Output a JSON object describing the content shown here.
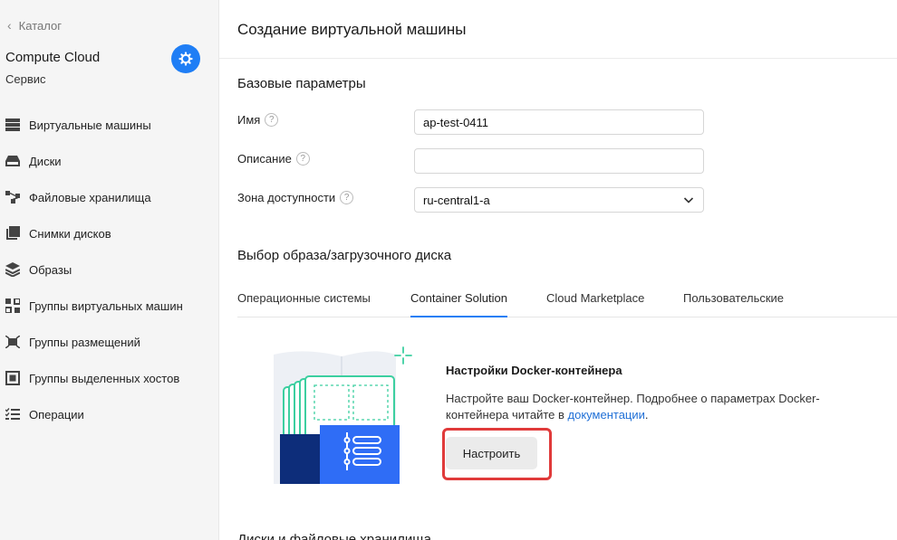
{
  "sidebar": {
    "back_label": "Каталог",
    "service_title": "Compute Cloud",
    "service_subtitle": "Сервис",
    "items": [
      {
        "label": "Виртуальные машины",
        "icon": "server-list-icon"
      },
      {
        "label": "Диски",
        "icon": "disk-icon"
      },
      {
        "label": "Файловые хранилища",
        "icon": "file-storage-icon"
      },
      {
        "label": "Снимки дисков",
        "icon": "snapshots-icon"
      },
      {
        "label": "Образы",
        "icon": "images-layers-icon"
      },
      {
        "label": "Группы виртуальных машин",
        "icon": "vm-groups-icon"
      },
      {
        "label": "Группы размещений",
        "icon": "placement-groups-icon"
      },
      {
        "label": "Группы выделенных хостов",
        "icon": "dedicated-hosts-icon"
      },
      {
        "label": "Операции",
        "icon": "operations-list-icon"
      }
    ]
  },
  "main": {
    "title": "Создание виртуальной машины",
    "basic_section": "Базовые параметры",
    "fields": {
      "name_label": "Имя",
      "name_value": "ap-test-0411",
      "description_label": "Описание",
      "description_value": "",
      "zone_label": "Зона доступности",
      "zone_value": "ru-central1-a"
    },
    "image_section": "Выбор образа/загрузочного диска",
    "tabs": [
      {
        "label": "Операционные системы",
        "active": false
      },
      {
        "label": "Container Solution",
        "active": true
      },
      {
        "label": "Cloud Marketplace",
        "active": false
      },
      {
        "label": "Пользовательские",
        "active": false
      }
    ],
    "docker": {
      "title": "Настройки Docker-контейнера",
      "text": "Настройте ваш Docker-контейнер. Подробнее о параметрах Docker-контейнера читайте в ",
      "link": "документации",
      "text_end": ".",
      "button": "Настроить"
    },
    "cut_off_section": "Диски и файловые хранилища"
  },
  "colors": {
    "accent": "#1f7ef5",
    "highlight": "#e03a3a",
    "link": "#1f6fd6"
  }
}
